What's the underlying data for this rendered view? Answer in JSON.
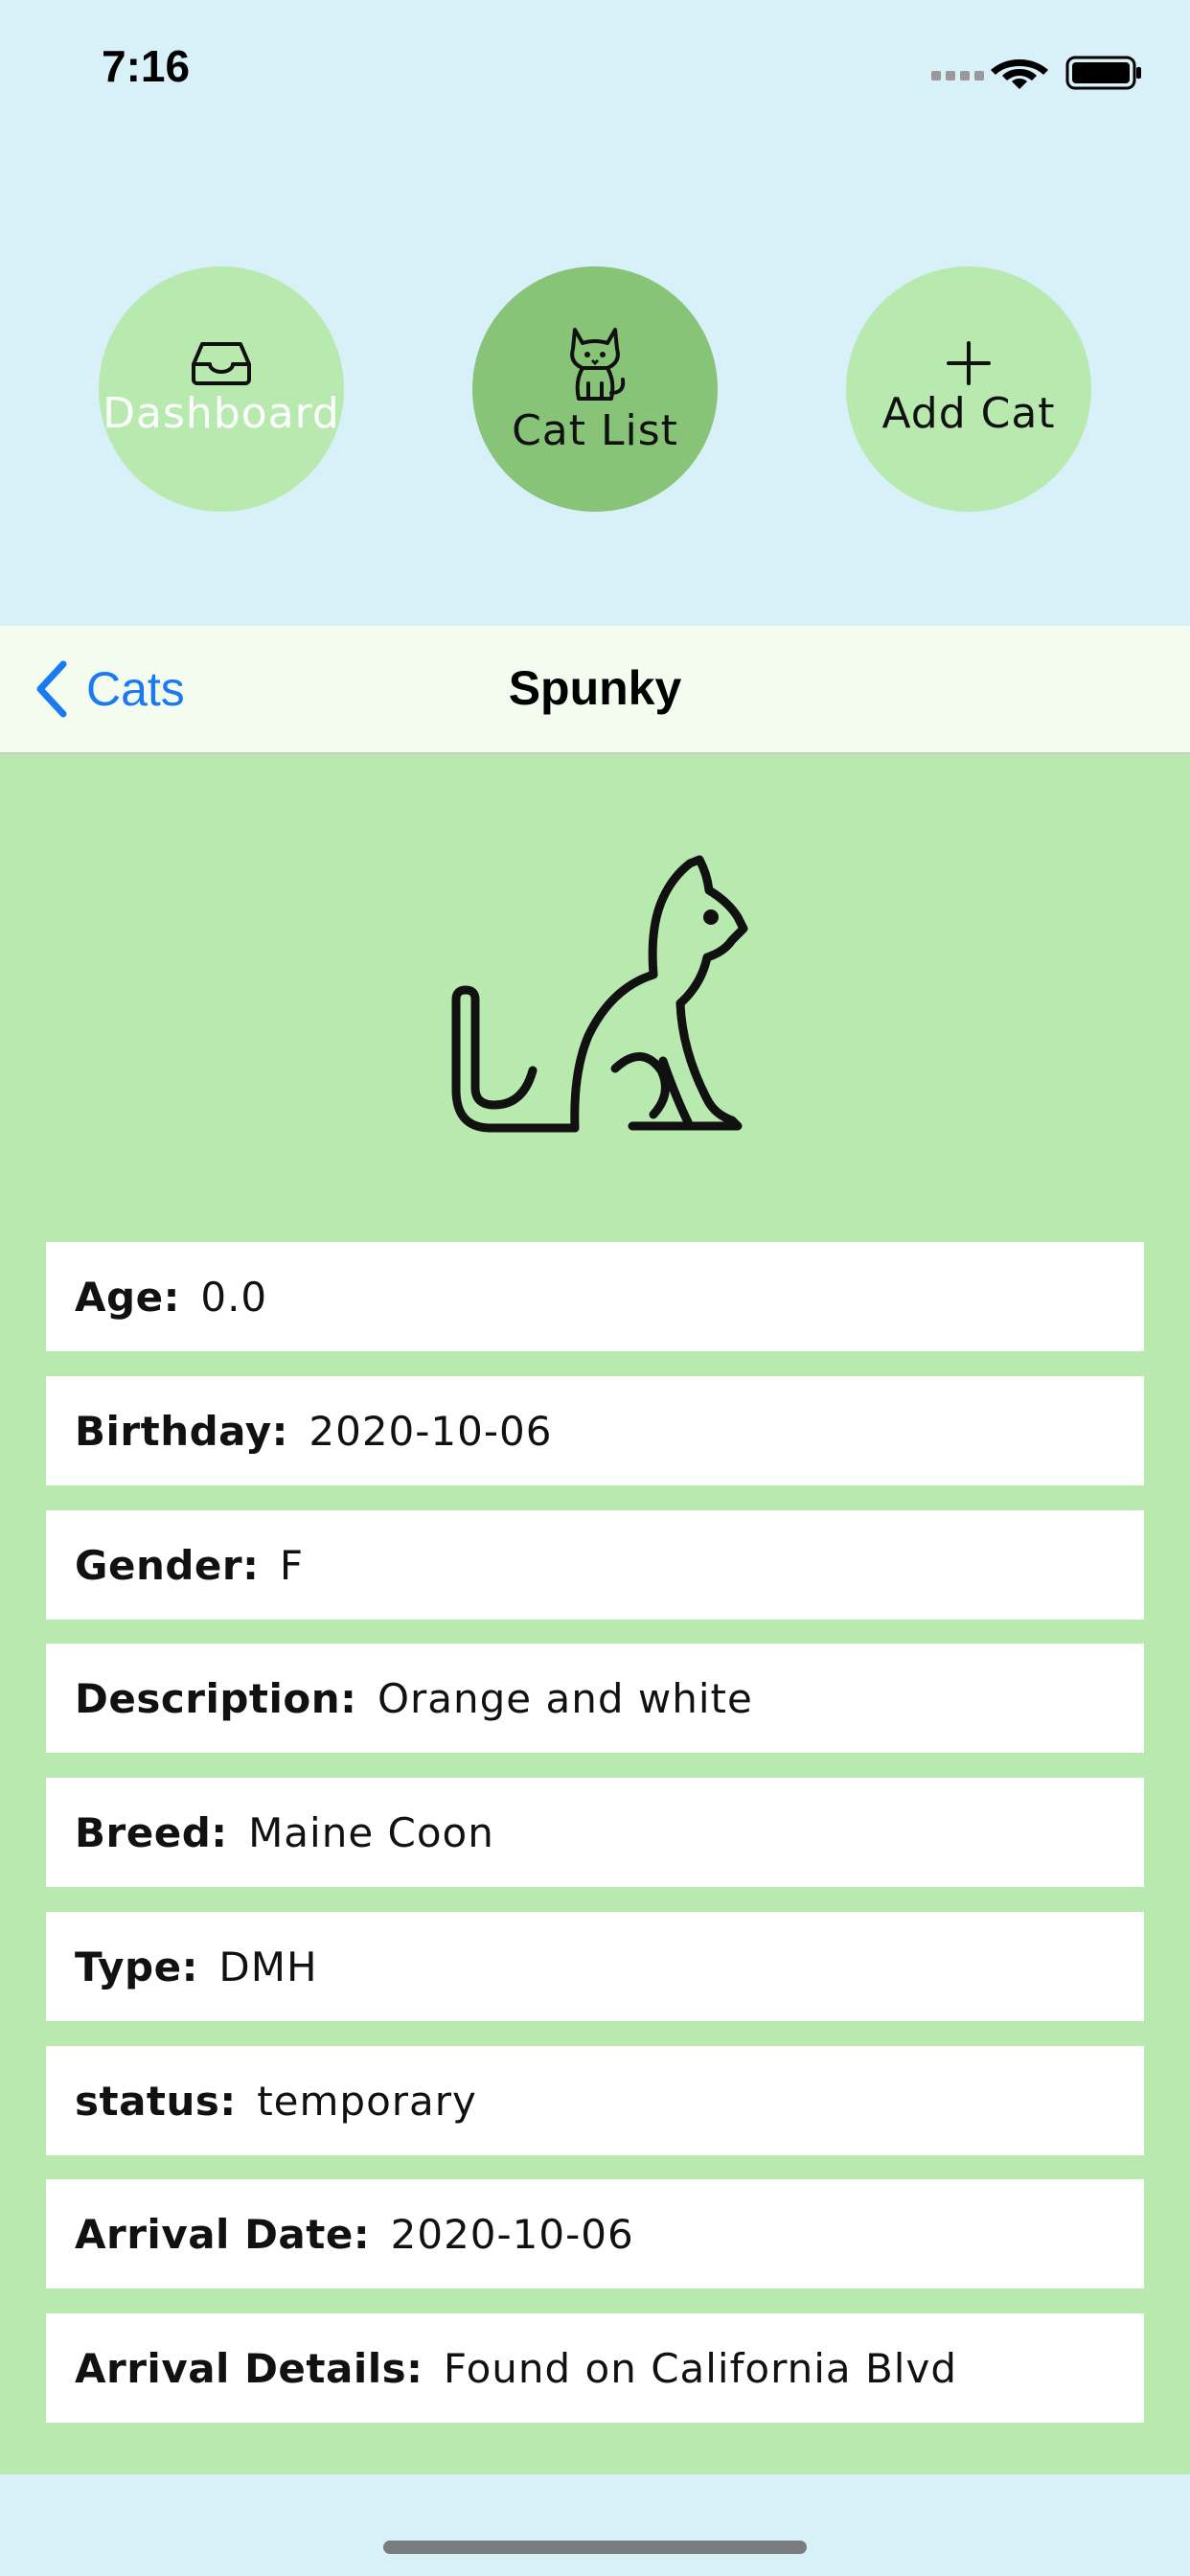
{
  "status_bar": {
    "time": "7:16"
  },
  "tabs": [
    {
      "label": "Dashboard",
      "icon": "tray-icon",
      "selected": false
    },
    {
      "label": "Cat List",
      "icon": "cat-icon",
      "selected": true
    },
    {
      "label": "Add Cat",
      "icon": "plus-icon",
      "selected": false
    }
  ],
  "nav": {
    "back_label": "Cats",
    "title": "Spunky"
  },
  "details": [
    {
      "label": "Age",
      "value": "0.0"
    },
    {
      "label": "Birthday",
      "value": "2020-10-06"
    },
    {
      "label": "Gender",
      "value": "F"
    },
    {
      "label": "Description",
      "value": "Orange and white"
    },
    {
      "label": "Breed",
      "value": "Maine Coon"
    },
    {
      "label": "Type",
      "value": "DMH"
    },
    {
      "label": "status",
      "value": "temporary"
    },
    {
      "label": "Arrival Date",
      "value": "2020-10-06"
    },
    {
      "label": "Arrival Details",
      "value": "Found on California Blvd"
    }
  ],
  "colors": {
    "background": "#d8f0f8",
    "content_green": "#b8eab0",
    "selected_tab": "#88c478",
    "link_blue": "#1a7bf0"
  }
}
